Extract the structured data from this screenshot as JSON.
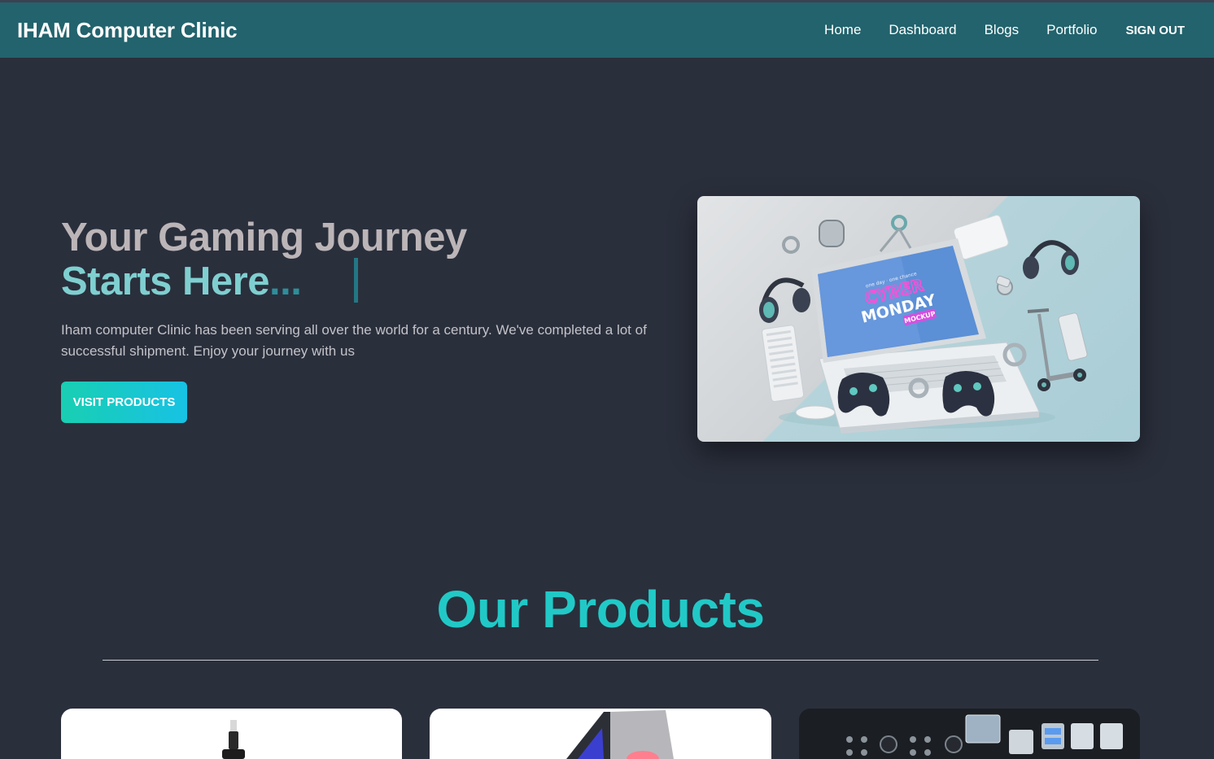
{
  "navbar": {
    "brand": "IHAM Computer Clinic",
    "links": [
      "Home",
      "Dashboard",
      "Blogs",
      "Portfolio"
    ],
    "signout_label": "SIGN OUT"
  },
  "hero": {
    "title_line1": "Your Gaming Journey",
    "title_line2": "Starts Here",
    "title_ellipsis": "...",
    "description": "Iham computer Clinic has been serving all over the world for a century. We've completed a lot of successful shipment. Enjoy your journey with us",
    "button_label": "VISIT PRODUCTS",
    "image": {
      "screen_text_small": "one day · one chance",
      "screen_text_1": "CYBER",
      "screen_text_2": "MONDAY",
      "screen_text_3": "MOCKUP"
    }
  },
  "products": {
    "heading": "Our Products"
  },
  "colors": {
    "background": "#2a2f3c",
    "navbar": "#22636d",
    "accent": "#21c9c6",
    "title_gray": "#bcb5b8",
    "title_teal": "#7fcfd0"
  }
}
